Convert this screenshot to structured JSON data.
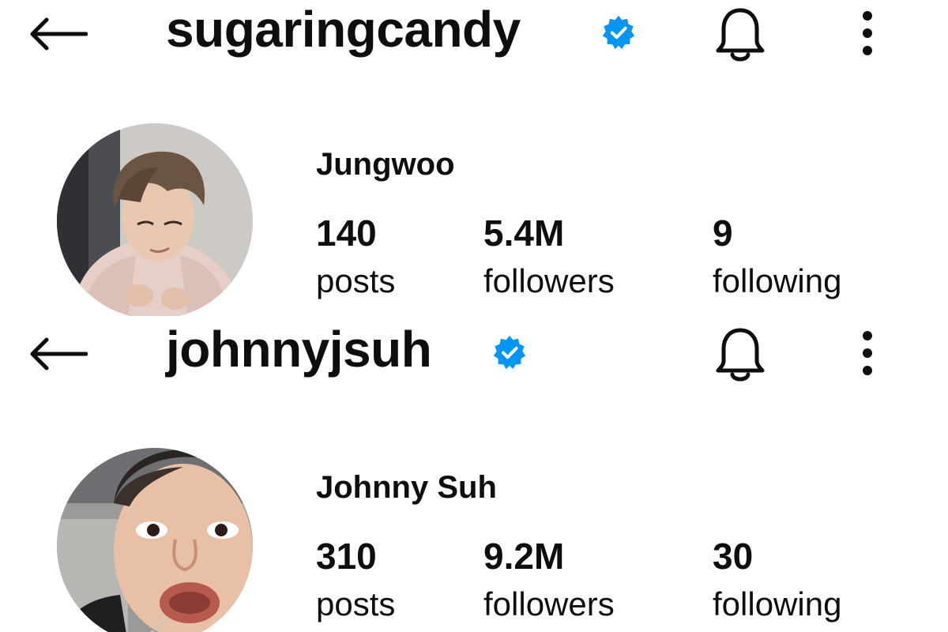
{
  "profiles": [
    {
      "username": "sugaringcandy",
      "verified": true,
      "display_name": "Jungwoo",
      "stats": {
        "posts_count": "140",
        "posts_label": "posts",
        "followers_count": "5.4M",
        "followers_label": "followers",
        "following_count": "9",
        "following_label": "following"
      }
    },
    {
      "username": "johnnyjsuh",
      "verified": true,
      "display_name": "Johnny Suh",
      "stats": {
        "posts_count": "310",
        "posts_label": "posts",
        "followers_count": "9.2M",
        "followers_label": "followers",
        "following_count": "30",
        "following_label": "following"
      }
    }
  ],
  "icons": {
    "back": "back-arrow-icon",
    "verified": "verified-badge-icon",
    "notifications": "bell-icon",
    "more": "more-options-icon"
  },
  "colors": {
    "text": "#0e0e0e",
    "verified_badge": "#0095f6",
    "background": "#ffffff"
  }
}
